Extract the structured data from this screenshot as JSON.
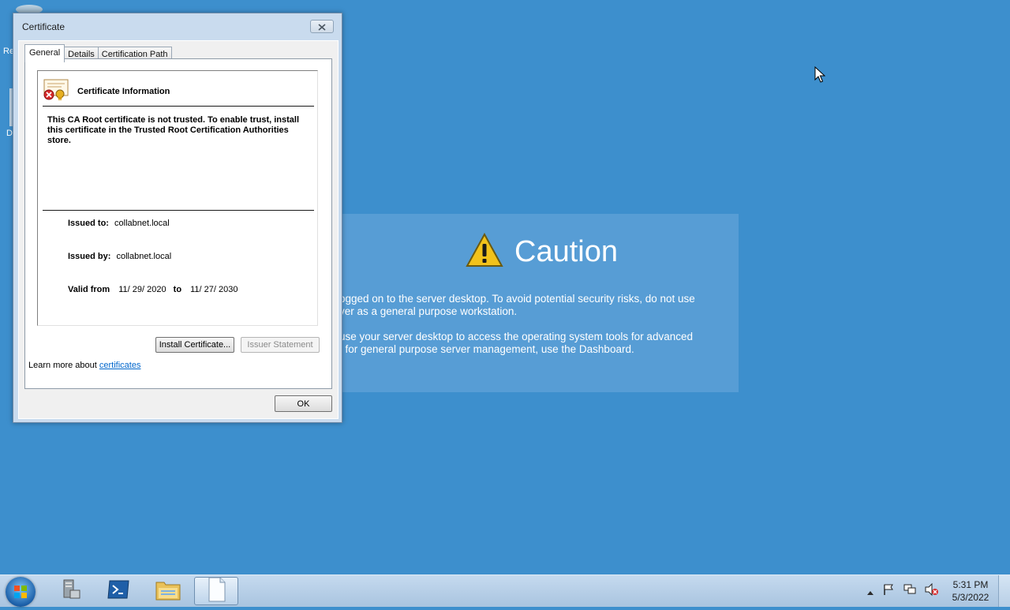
{
  "desktop": {
    "icon1_label": "Re",
    "icon2_label": "D"
  },
  "caution": {
    "title": "Caution",
    "line1": "ogged on to the server desktop. To avoid potential security risks, do not use",
    "line2": "ver as a general purpose workstation.",
    "line3": "use your server desktop to access the operating system tools for advanced",
    "line4": "t for general purpose server management, use the Dashboard."
  },
  "dialog": {
    "title": "Certificate",
    "tabs": [
      "General",
      "Details",
      "Certification Path"
    ],
    "cert_info_heading": "Certificate Information",
    "warning_text": "This CA Root certificate is not trusted. To enable trust, install this certificate in the Trusted Root Certification Authorities store.",
    "issued_to_label": "Issued to:",
    "issued_to_value": "collabnet.local",
    "issued_by_label": "Issued by:",
    "issued_by_value": "collabnet.local",
    "valid_from_label": "Valid from",
    "valid_from_value": "11/ 29/ 2020",
    "to_label": "to",
    "valid_to_value": "11/ 27/ 2030",
    "install_button": "Install Certificate...",
    "issuer_statement_button": "Issuer Statement",
    "learn_more_text": "Learn more about ",
    "learn_more_link": "certificates",
    "ok_button": "OK"
  },
  "taskbar": {
    "time": "5:31 PM",
    "date": "5/3/2022",
    "apps": [
      "server-manager",
      "powershell",
      "file-explorer",
      "document"
    ]
  },
  "colors": {
    "desktop_bg": "#3d8fcd",
    "link": "#0066cc"
  }
}
